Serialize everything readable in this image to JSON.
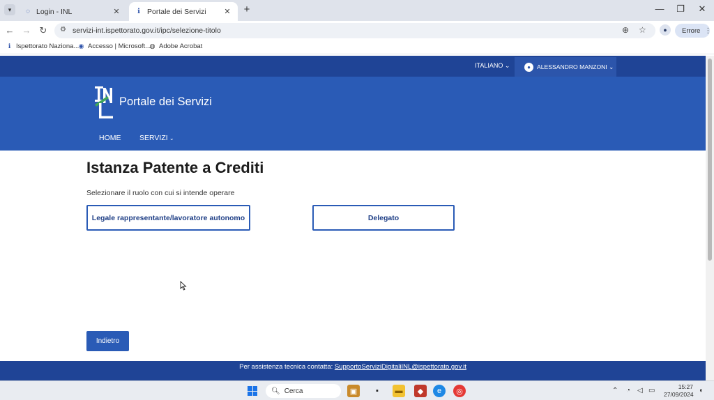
{
  "browser": {
    "tabs": [
      {
        "label": "Login - INL"
      },
      {
        "label": "Portale dei Servizi"
      }
    ],
    "url": "servizi-int.ispettorato.gov.it/ipc/selezione-titolo",
    "error_label": "Errore",
    "bookmarks": [
      {
        "label": "Ispettorato Naziona..."
      },
      {
        "label": "Accesso | Microsoft..."
      },
      {
        "label": "Adobe Acrobat"
      }
    ]
  },
  "topbar": {
    "language": "ITALIANO",
    "user": "ALESSANDRO MANZONI"
  },
  "header": {
    "site_title": "Portale dei Servizi",
    "nav": [
      {
        "label": "HOME"
      },
      {
        "label": "SERVIZI"
      }
    ]
  },
  "main": {
    "title": "Istanza Patente a Crediti",
    "subtitle": "Selezionare il ruolo con cui si intende operare",
    "roles": [
      {
        "label": "Legale rappresentante/lavoratore autonomo"
      },
      {
        "label": "Delegato"
      }
    ],
    "back_label": "Indietro"
  },
  "footer": {
    "text": "Per assistenza tecnica contatta:",
    "email": "SupportoServiziDigitaliINL@ispettorato.gov.it"
  },
  "taskbar": {
    "search_label": "Cerca",
    "time": "15:27",
    "date": "27/09/2024"
  },
  "colors": {
    "brand_blue": "#2a5bb6",
    "dark_blue": "#1f4496"
  }
}
